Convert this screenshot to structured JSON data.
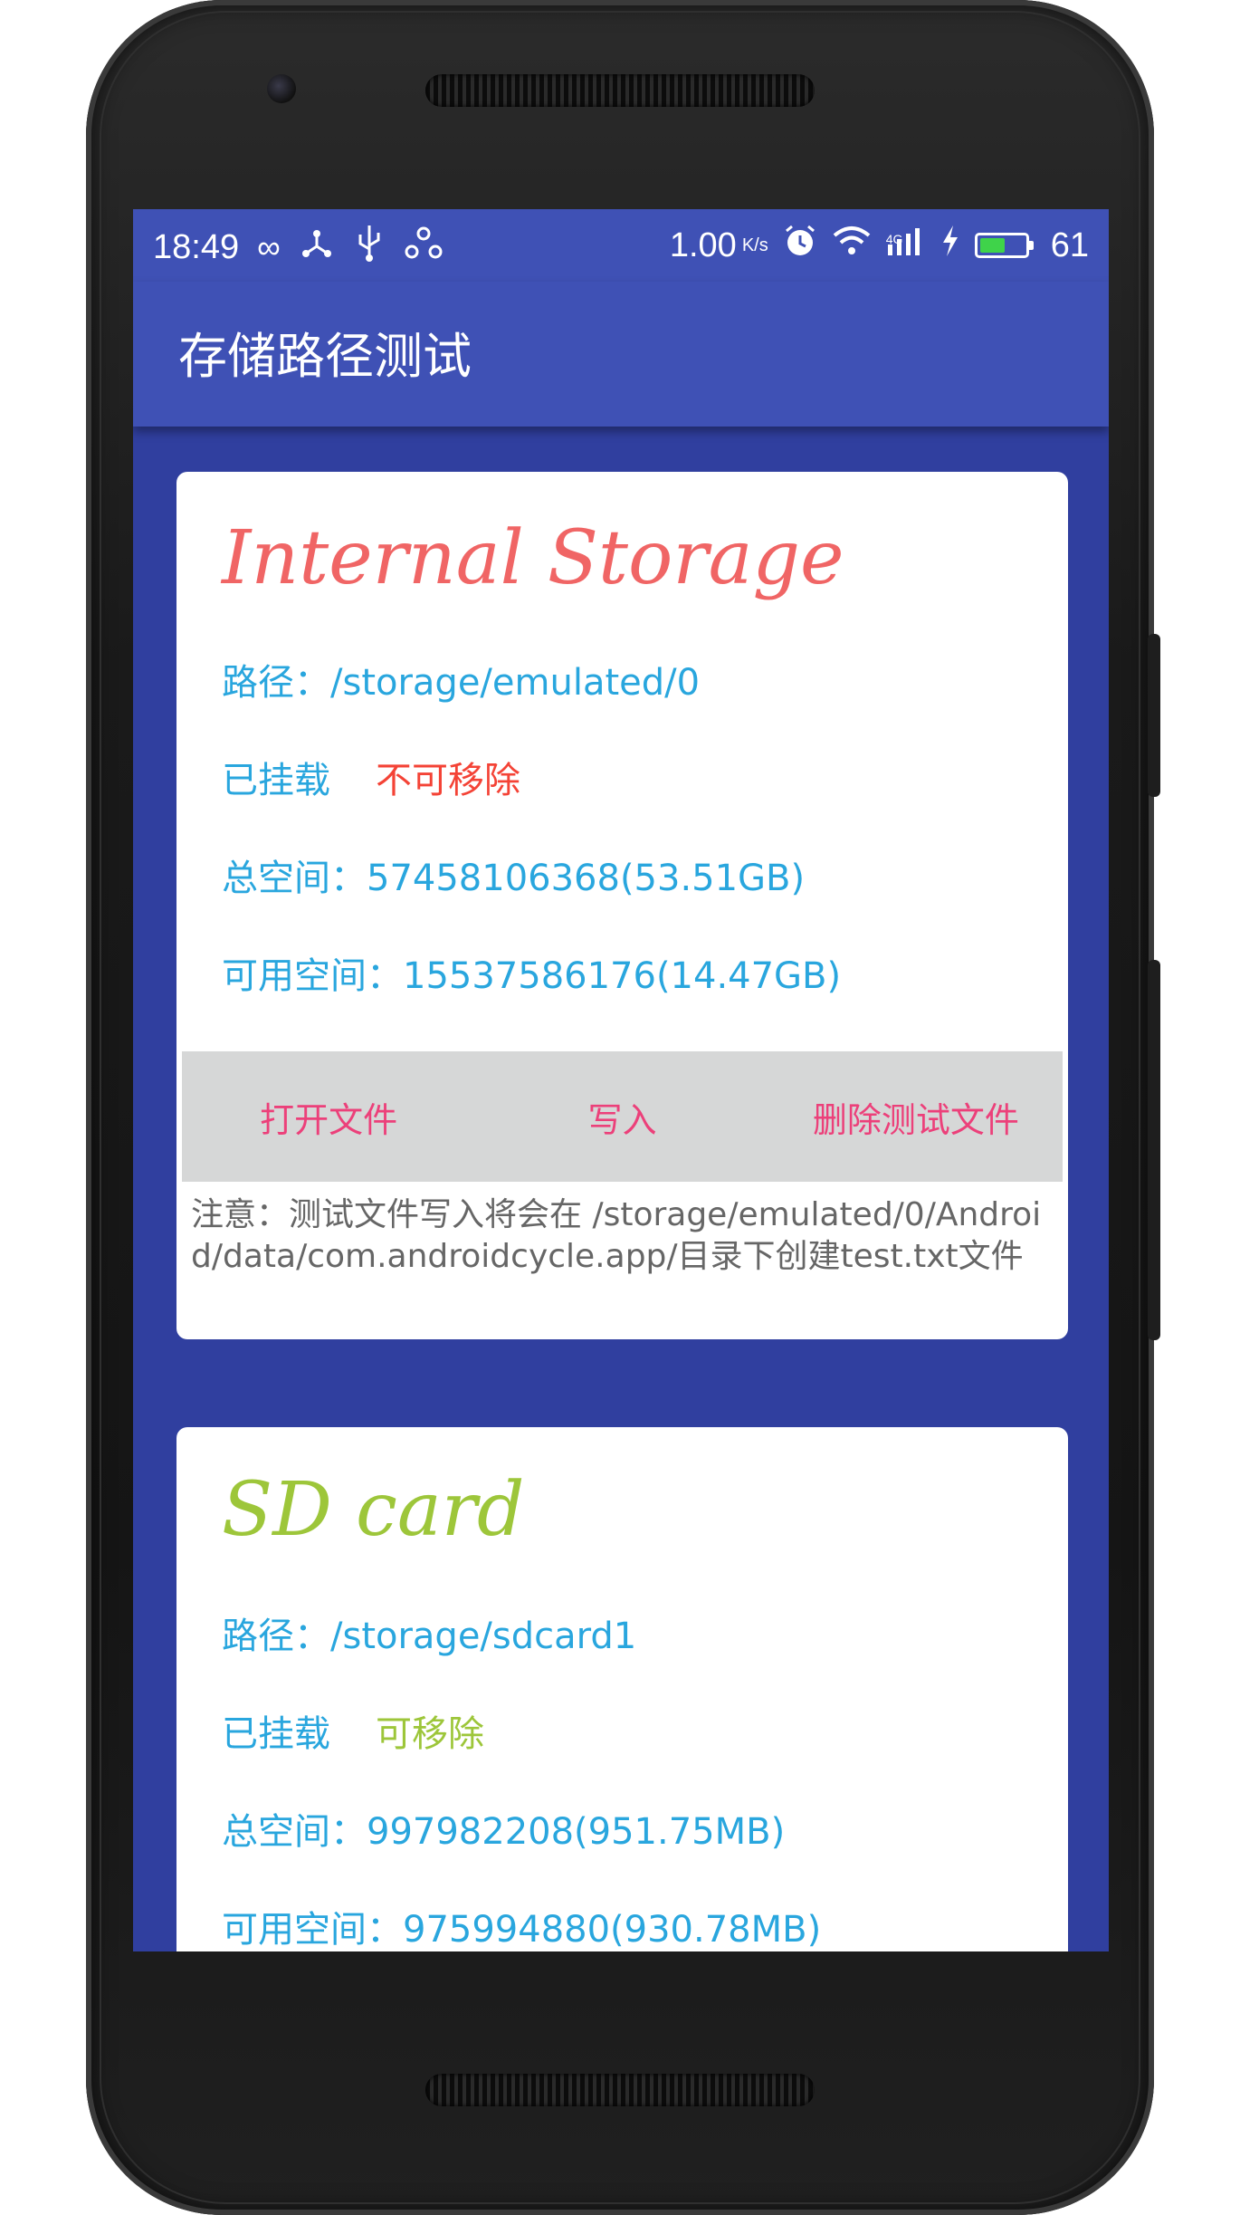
{
  "status_bar": {
    "time": "18:49",
    "speed": "1.00",
    "speed_unit": "K/s",
    "network": "4G",
    "battery": "61",
    "battery_level_percent": 61,
    "left_icons": [
      "infinity-icon",
      "usb-debug-icon",
      "usb-icon",
      "share-icon"
    ],
    "right_icons": [
      "alarm-icon",
      "wifi-icon",
      "signal-icon",
      "charging-icon",
      "battery-icon"
    ]
  },
  "app_bar": {
    "title": "存储路径测试"
  },
  "internal": {
    "title": "Internal Storage",
    "path_label": "路径：",
    "path_value": "/storage/emulated/0",
    "mounted_label": "已挂载",
    "removable": "不可移除",
    "total_label": "总空间：",
    "total_value": "57458106368(53.51GB)",
    "free_label": "可用空间：",
    "free_value": "15537586176(14.47GB)",
    "buttons": {
      "open": "打开文件",
      "write": "写入",
      "delete": "删除测试文件"
    },
    "note": "注意：测试文件写入将会在 /storage/emulated/0/Android/data/com.androidcycle.app/目录下创建test.txt文件"
  },
  "sdcard": {
    "title": "SD card",
    "path_label": "路径：",
    "path_value": "/storage/sdcard1",
    "mounted_label": "已挂载",
    "removable": "可移除",
    "total_label": "总空间：",
    "total_value": "997982208(951.75MB)",
    "free_label": "可用空间：",
    "free_value": "975994880(930.78MB)"
  },
  "colors": {
    "primary": "#3f51b5",
    "primary_dark": "#303f9f",
    "info_text": "#29a6de",
    "internal_title": "#f06565",
    "sd_title": "#9dc63a",
    "button_text": "#ec407a",
    "not_removable": "#f44336"
  }
}
